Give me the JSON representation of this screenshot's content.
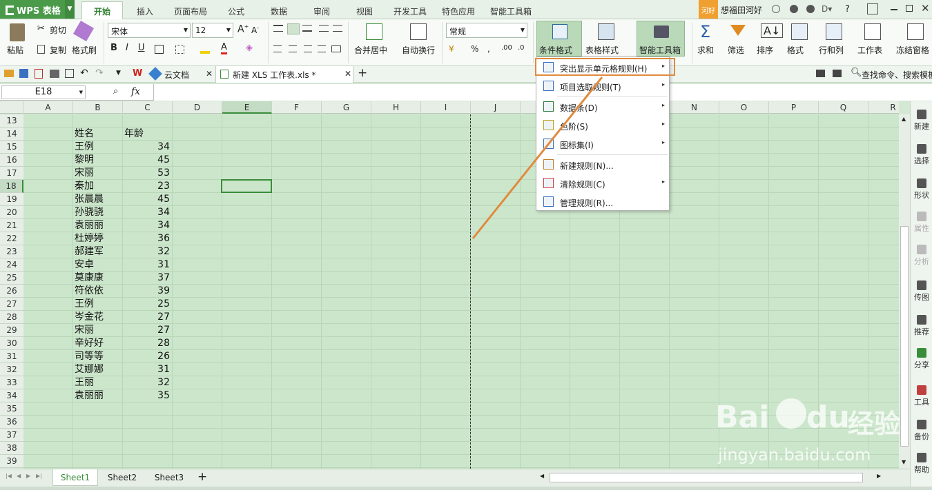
{
  "app": {
    "title": "WPS 表格"
  },
  "menu": {
    "home": "开始",
    "insert": "插入",
    "layout": "页面布局",
    "formula": "公式",
    "data": "数据",
    "review": "审阅",
    "view": "视图",
    "dev": "开发工具",
    "special": "特色应用",
    "smart": "智能工具箱"
  },
  "titlebar": {
    "badge": "河好",
    "user": "想福田河好",
    "help": "?"
  },
  "ribbon": {
    "paste": "粘贴",
    "cut": "剪切",
    "copy": "复制",
    "format_painter": "格式刷",
    "font_name": "宋体",
    "font_size": "12",
    "merge_center": "合并居中",
    "wrap": "自动换行",
    "number_format": "常规",
    "cond_format": "条件格式",
    "table_style": "表格样式",
    "smart_toolbox": "智能工具箱",
    "sum": "求和",
    "filter": "筛选",
    "sort": "排序",
    "format": "格式",
    "rows_cols": "行和列",
    "worksheet": "工作表",
    "freeze": "冻结窗格"
  },
  "quickbar": {
    "tab1": "云文档",
    "tab2": "新建 XLS 工作表.xls *",
    "search": "查找命令、搜索模板"
  },
  "formula": {
    "cell_ref": "E18",
    "fx": "fx"
  },
  "columns": [
    "A",
    "B",
    "C",
    "D",
    "E",
    "F",
    "G",
    "H",
    "I",
    "J",
    "K",
    "L",
    "M",
    "N",
    "O",
    "P",
    "Q",
    "R"
  ],
  "rows": [
    "13",
    "14",
    "15",
    "16",
    "17",
    "18",
    "19",
    "20",
    "21",
    "22",
    "23",
    "24",
    "25",
    "26",
    "27",
    "28",
    "29",
    "30",
    "31",
    "32",
    "33",
    "34",
    "35",
    "36",
    "37",
    "38",
    "39"
  ],
  "table": {
    "header": [
      "姓名",
      "年龄"
    ],
    "data": [
      [
        "王例",
        "34"
      ],
      [
        "黎明",
        "45"
      ],
      [
        "宋丽",
        "53"
      ],
      [
        "秦加",
        "23"
      ],
      [
        "张晨晨",
        "45"
      ],
      [
        "孙骁骁",
        "34"
      ],
      [
        "袁丽丽",
        "34"
      ],
      [
        "杜婷婷",
        "36"
      ],
      [
        "郝建军",
        "32"
      ],
      [
        "安卓",
        "31"
      ],
      [
        "莫康康",
        "37"
      ],
      [
        "符依依",
        "39"
      ],
      [
        "王例",
        "25"
      ],
      [
        "岑金花",
        "27"
      ],
      [
        "宋丽",
        "27"
      ],
      [
        "辛好好",
        "28"
      ],
      [
        "司等等",
        "26"
      ],
      [
        "艾娜娜",
        "31"
      ],
      [
        "王丽",
        "32"
      ],
      [
        "袁丽丽",
        "35"
      ]
    ]
  },
  "dropdown": [
    {
      "label": "突出显示单元格规则(H)",
      "submenu": true
    },
    {
      "label": "项目选取规则(T)",
      "submenu": true
    },
    {
      "label": "数据条(D)",
      "submenu": true
    },
    {
      "label": "色阶(S)",
      "submenu": true
    },
    {
      "label": "图标集(I)",
      "submenu": true
    },
    {
      "label": "新建规则(N)...",
      "submenu": false
    },
    {
      "label": "清除规则(C)",
      "submenu": true
    },
    {
      "label": "管理规则(R)...",
      "submenu": false
    }
  ],
  "sidebar": [
    "新建",
    "选择",
    "形状",
    "属性",
    "分析",
    "传图",
    "推荐",
    "分享",
    "工具",
    "备份",
    "帮助"
  ],
  "sheets": [
    "Sheet1",
    "Sheet2",
    "Sheet3"
  ],
  "watermark": {
    "brand": "Bai",
    "brand2": "du",
    "cn": "经验",
    "url": "jingyan.baidu.com"
  },
  "colors": {
    "accent": "#4a9a4a",
    "grid_bg": "#cce6cc",
    "highlight": "#e08a3c"
  }
}
